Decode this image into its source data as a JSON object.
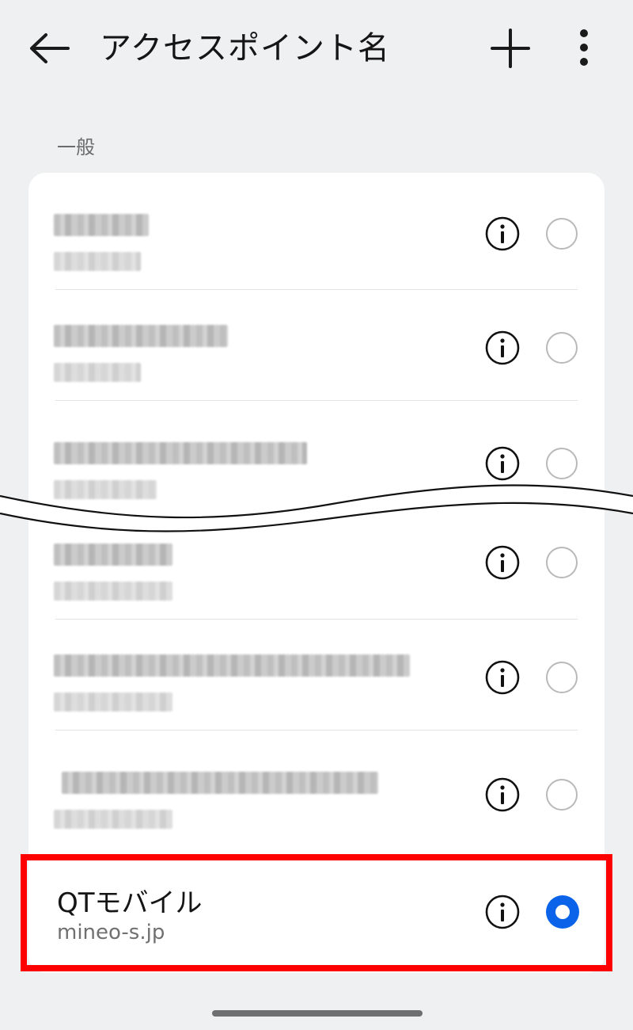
{
  "header": {
    "title": "アクセスポイント名",
    "back_icon": "back-arrow-icon",
    "add_icon": "plus-icon",
    "more_icon": "more-vertical-icon"
  },
  "section": {
    "label": "一般"
  },
  "apn_list": [
    {
      "selected": false
    },
    {
      "selected": false
    },
    {
      "selected": false
    },
    {
      "selected": false
    },
    {
      "selected": false
    },
    {
      "selected": false
    },
    {
      "name": "QTモバイル",
      "apn": "mineo-s.jp",
      "selected": true
    }
  ],
  "colors": {
    "background": "#eff0f2",
    "card": "#ffffff",
    "radio_selected": "#0a63e8",
    "highlight_border": "#ff0000"
  }
}
